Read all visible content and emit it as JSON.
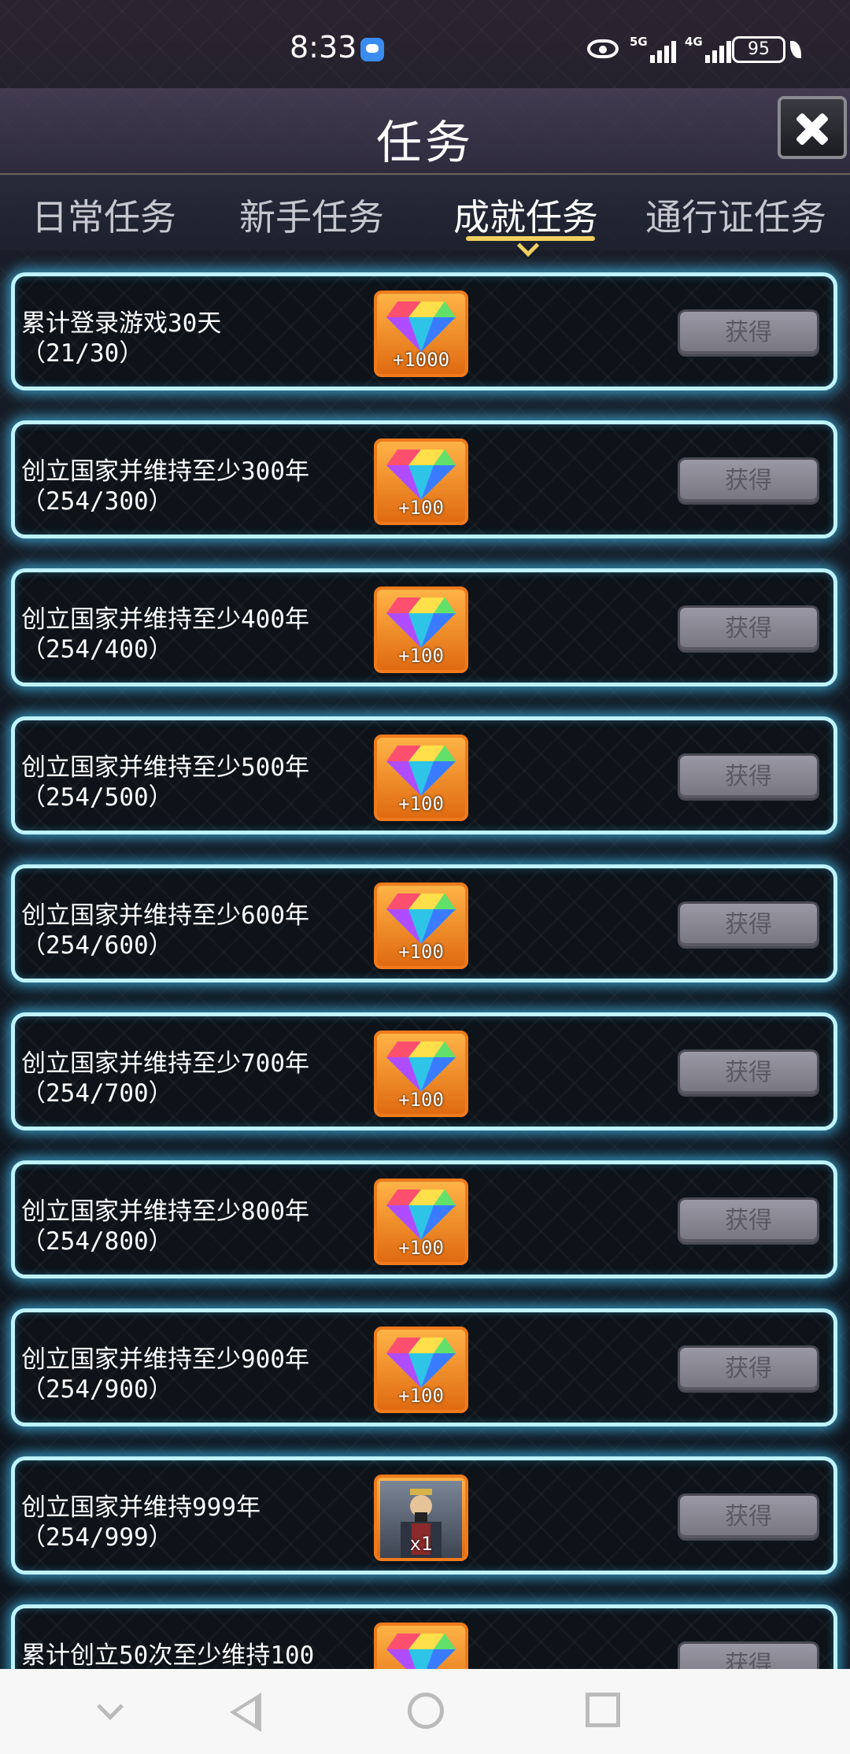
{
  "status_bar": {
    "time": "8:33",
    "network1": "5G",
    "network2": "4G",
    "battery": "95"
  },
  "header": {
    "title": "任务",
    "close_icon": "close-icon"
  },
  "tabs": [
    {
      "label": "日常任务",
      "active": false
    },
    {
      "label": "新手任务",
      "active": false
    },
    {
      "label": "成就任务",
      "active": true
    },
    {
      "label": "通行证任务",
      "active": false
    }
  ],
  "colors": {
    "row_glow": "#46c8ff",
    "reward_frame": "#f07a1c",
    "tab_underline": "#f0d060",
    "button_gray": "#8a8894"
  },
  "tasks": [
    {
      "title": "累计登录游戏30天",
      "progress": "（21/30）",
      "reward_icon": "gem-icon",
      "reward_amount": "+1000",
      "button": "获得"
    },
    {
      "title": "创立国家并维持至少300年",
      "progress": "（254/300）",
      "reward_icon": "gem-icon",
      "reward_amount": "+100",
      "button": "获得"
    },
    {
      "title": "创立国家并维持至少400年",
      "progress": "（254/400）",
      "reward_icon": "gem-icon",
      "reward_amount": "+100",
      "button": "获得"
    },
    {
      "title": "创立国家并维持至少500年",
      "progress": "（254/500）",
      "reward_icon": "gem-icon",
      "reward_amount": "+100",
      "button": "获得"
    },
    {
      "title": "创立国家并维持至少600年",
      "progress": "（254/600）",
      "reward_icon": "gem-icon",
      "reward_amount": "+100",
      "button": "获得"
    },
    {
      "title": "创立国家并维持至少700年",
      "progress": "（254/700）",
      "reward_icon": "gem-icon",
      "reward_amount": "+100",
      "button": "获得"
    },
    {
      "title": "创立国家并维持至少800年",
      "progress": "（254/800）",
      "reward_icon": "gem-icon",
      "reward_amount": "+100",
      "button": "获得"
    },
    {
      "title": "创立国家并维持至少900年",
      "progress": "（254/900）",
      "reward_icon": "gem-icon",
      "reward_amount": "+100",
      "button": "获得"
    },
    {
      "title": "创立国家并维持999年",
      "progress": "（254/999）",
      "reward_icon": "hero-portrait-icon",
      "reward_amount": "x1",
      "button": "获得"
    },
    {
      "title": "累计创立50次至少维持100",
      "progress": "",
      "reward_icon": "gem-icon",
      "reward_amount": "",
      "button": "获得"
    }
  ],
  "nav_bar": {
    "icons": [
      "chevron-down-icon",
      "back-icon",
      "home-icon",
      "recents-icon"
    ]
  }
}
